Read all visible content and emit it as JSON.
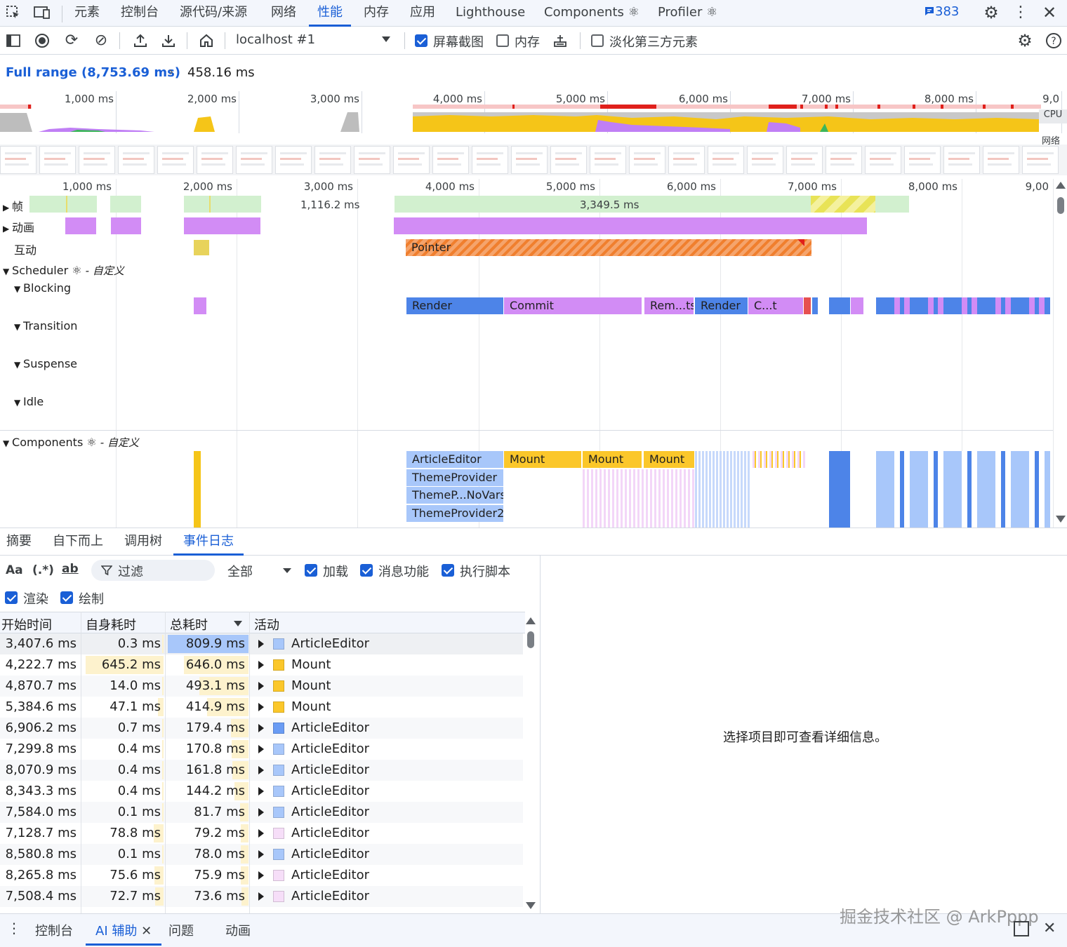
{
  "topbar": {
    "tabs": [
      "元素",
      "控制台",
      "源代码/来源",
      "网络",
      "性能",
      "内存",
      "应用",
      "Lighthouse",
      "Components ⚛",
      "Profiler ⚛"
    ],
    "active_tab": "性能",
    "issues_count": "383"
  },
  "toolbar": {
    "target": "localhost #1",
    "screenshots_label": "屏幕截图",
    "memory_label": "内存",
    "dim_third_party_label": "淡化第三方元素"
  },
  "range": {
    "full_range": "Full range (8,753.69 ms)",
    "selected": "458.16 ms"
  },
  "overview": {
    "ticks": [
      "1,000 ms",
      "2,000 ms",
      "3,000 ms",
      "4,000 ms",
      "5,000 ms",
      "6,000 ms",
      "7,000 ms",
      "8,000 ms",
      "9,0"
    ],
    "cpu_label": "CPU",
    "net_label": "网络"
  },
  "timeline": {
    "ticks": [
      "1,000 ms",
      "2,000 ms",
      "3,000 ms",
      "4,000 ms",
      "5,000 ms",
      "6,000 ms",
      "7,000 ms",
      "8,000 ms",
      "9,00"
    ],
    "tracks": {
      "frames": "帧",
      "animations": "动画",
      "interactions": "互动",
      "scheduler": "Scheduler ⚛",
      "custom": "- 自定义",
      "blocking": "Blocking",
      "transition": "Transition",
      "suspense": "Suspense",
      "idle": "Idle",
      "components": "Components ⚛"
    },
    "frame_labels": [
      "1,116.2 ms",
      "3,349.5 ms"
    ],
    "interaction_label": "Pointer",
    "scheduler_blocks": [
      "Render",
      "Commit",
      "Rem...ts",
      "Render",
      "C...t"
    ],
    "component_blocks": [
      "ArticleEditor",
      "Mount",
      "Mount",
      "Mount",
      "ThemeProvider",
      "ThemeP...NoVars",
      "ThemeProvider2"
    ]
  },
  "bottom_tabs": [
    "摘要",
    "自下而上",
    "调用树",
    "事件日志"
  ],
  "active_bottom_tab": "事件日志",
  "filter": {
    "placeholder": "过滤",
    "scope": "全部",
    "loading": "加载",
    "messaging": "消息功能",
    "scripting": "执行脚本",
    "rendering": "渲染",
    "painting": "绘制"
  },
  "table": {
    "headers": [
      "开始时间",
      "自身耗时",
      "总耗时",
      "活动"
    ],
    "rows": [
      {
        "start": "3,407.6 ms",
        "self": "0.3 ms",
        "total": "809.9 ms",
        "activity": "ArticleEditor",
        "color": "#a8c7fa"
      },
      {
        "start": "4,222.7 ms",
        "self": "645.2 ms",
        "total": "646.0 ms",
        "activity": "Mount",
        "color": "#fbc72a"
      },
      {
        "start": "4,870.7 ms",
        "self": "14.0 ms",
        "total": "493.1 ms",
        "activity": "Mount",
        "color": "#fbc72a"
      },
      {
        "start": "5,384.6 ms",
        "self": "47.1 ms",
        "total": "414.9 ms",
        "activity": "Mount",
        "color": "#fbc72a"
      },
      {
        "start": "6,906.2 ms",
        "self": "0.7 ms",
        "total": "179.4 ms",
        "activity": "ArticleEditor",
        "color": "#6a9cf4"
      },
      {
        "start": "7,299.8 ms",
        "self": "0.4 ms",
        "total": "170.8 ms",
        "activity": "ArticleEditor",
        "color": "#a8c7fa"
      },
      {
        "start": "8,070.9 ms",
        "self": "0.4 ms",
        "total": "161.8 ms",
        "activity": "ArticleEditor",
        "color": "#a8c7fa"
      },
      {
        "start": "8,343.3 ms",
        "self": "0.4 ms",
        "total": "144.2 ms",
        "activity": "ArticleEditor",
        "color": "#a8c7fa"
      },
      {
        "start": "7,584.0 ms",
        "self": "0.1 ms",
        "total": "81.7 ms",
        "activity": "ArticleEditor",
        "color": "#a8c7fa"
      },
      {
        "start": "7,128.7 ms",
        "self": "78.8 ms",
        "total": "79.2 ms",
        "activity": "ArticleEditor",
        "color": "#f6def8"
      },
      {
        "start": "8,580.8 ms",
        "self": "0.1 ms",
        "total": "78.0 ms",
        "activity": "ArticleEditor",
        "color": "#a8c7fa"
      },
      {
        "start": "8,265.8 ms",
        "self": "75.6 ms",
        "total": "75.9 ms",
        "activity": "ArticleEditor",
        "color": "#f6def8"
      },
      {
        "start": "7,508.4 ms",
        "self": "72.7 ms",
        "total": "73.6 ms",
        "activity": "ArticleEditor",
        "color": "#f6def8"
      }
    ]
  },
  "detail": {
    "empty_text": "选择项目即可查看详细信息。"
  },
  "drawer": {
    "tabs": [
      "控制台",
      "AI 辅助",
      "问题",
      "动画"
    ],
    "active": "AI 辅助"
  },
  "watermark": "掘金技术社区 @ ArkPppp"
}
